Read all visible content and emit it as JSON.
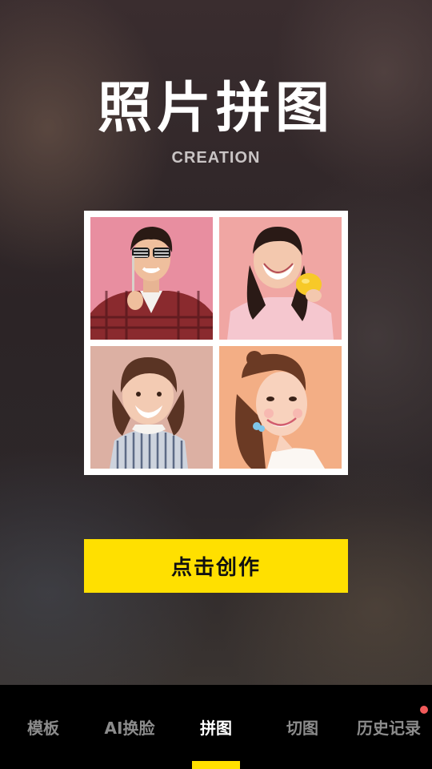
{
  "header": {
    "title": "照片拼图",
    "subtitle": "CREATION"
  },
  "collage": {
    "photos": [
      {
        "label": "man-with-sunglasses-photo"
      },
      {
        "label": "girl-with-orange-photo"
      },
      {
        "label": "little-girl-photo"
      },
      {
        "label": "young-woman-photo"
      }
    ]
  },
  "cta": {
    "label": "点击创作"
  },
  "tabs": [
    {
      "label": "模板",
      "active": false
    },
    {
      "label": "AI换脸",
      "active": false
    },
    {
      "label": "拼图",
      "active": true
    },
    {
      "label": "切图",
      "active": false
    },
    {
      "label": "历史记录",
      "active": false,
      "has_badge": true
    }
  ],
  "colors": {
    "accent": "#ffe000",
    "tab_active": "#ffffff",
    "tab_inactive": "#8c8c8c",
    "badge": "#f25a5a"
  }
}
